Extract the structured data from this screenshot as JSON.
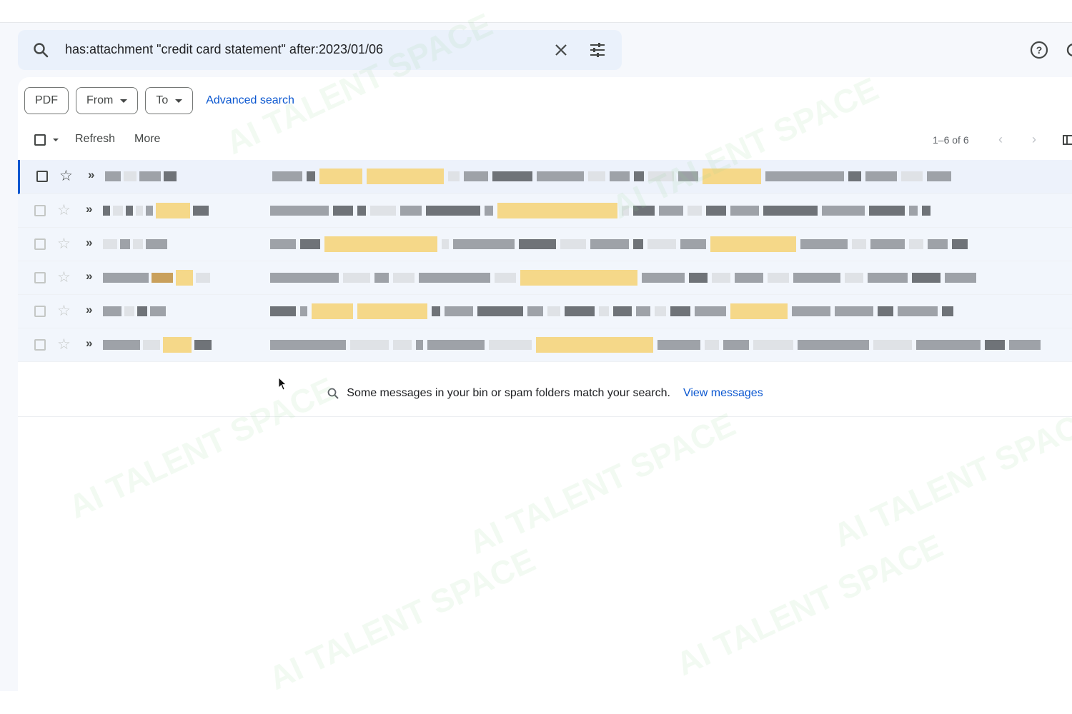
{
  "search": {
    "query": "has:attachment \"credit card statement\" after:2023/01/06"
  },
  "filters": {
    "chips": [
      {
        "label": "PDF",
        "dropdown": false
      },
      {
        "label": "From",
        "dropdown": true
      },
      {
        "label": "To",
        "dropdown": true
      }
    ],
    "advanced_search": "Advanced search"
  },
  "toolbar": {
    "refresh": "Refresh",
    "more": "More",
    "count": "1–6 of 6"
  },
  "messages": [
    {
      "redacted": true,
      "selected_style": true
    },
    {
      "redacted": true
    },
    {
      "redacted": true
    },
    {
      "redacted": true
    },
    {
      "redacted": true
    },
    {
      "redacted": true
    }
  ],
  "spam_notice": {
    "text": "Some messages in your bin or spam folders match your search.",
    "link": "View messages"
  },
  "watermark": "AI TALENT SPACE",
  "colors": {
    "accent": "#0b57d0",
    "search_bg": "#eaf1fb",
    "app_bg": "#f6f8fc",
    "highlight": "#f5d889"
  },
  "icons": [
    "search-icon",
    "close-icon",
    "tune-icon",
    "help-icon",
    "checkbox-icon",
    "star-icon",
    "importance-icon",
    "chevron-left-icon",
    "chevron-right-icon"
  ]
}
